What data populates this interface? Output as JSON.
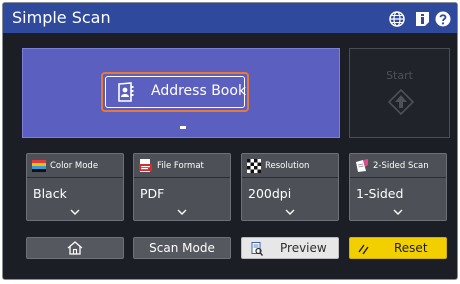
{
  "app": {
    "title": "Simple Scan"
  },
  "titlebar_icons": [
    "globe-icon",
    "info-icon",
    "help-icon"
  ],
  "main": {
    "address_book_label": "Address Book",
    "start_label": "Start"
  },
  "settings": [
    {
      "label": "Color Mode",
      "value": "Black",
      "icon": "color-mode-icon"
    },
    {
      "label": "File Format",
      "value": "PDF",
      "icon": "pdf-file-icon"
    },
    {
      "label": "Resolution",
      "value": "200dpi",
      "icon": "resolution-icon"
    },
    {
      "label": "2-Sided Scan",
      "value": "1-Sided",
      "icon": "two-sided-scan-icon"
    }
  ],
  "buttons": {
    "home_icon": "home-icon",
    "scan_mode": "Scan Mode",
    "preview": "Preview",
    "reset": "Reset"
  },
  "colors": {
    "title_bar": "#2f4a9c",
    "panel": "#5a5fc0",
    "highlight": "#e8783a",
    "reset": "#f2d000"
  }
}
